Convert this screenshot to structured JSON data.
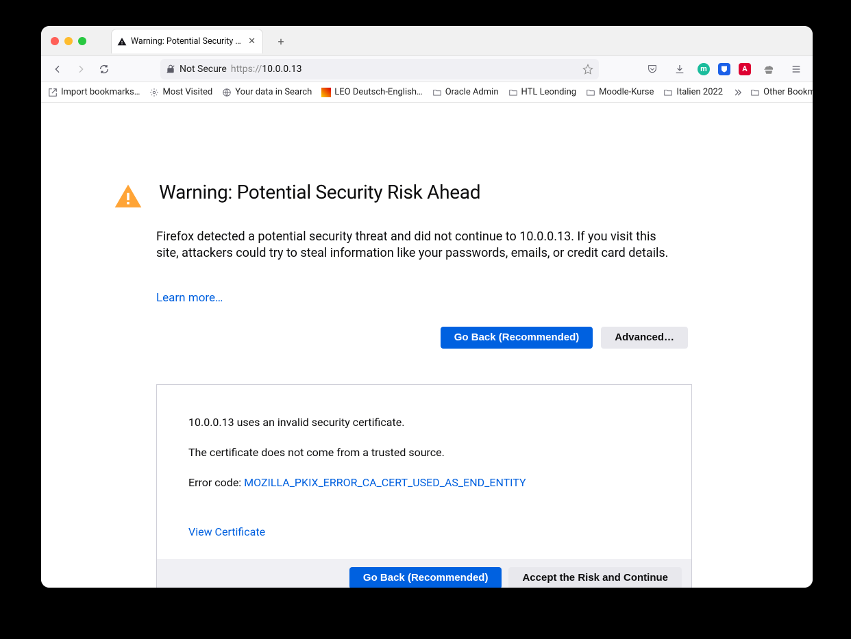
{
  "tab": {
    "title": "Warning: Potential Security Risk"
  },
  "url": {
    "security_label": "Not Secure",
    "protocol": "https://",
    "host": "10.0.0.13"
  },
  "bookmarks": {
    "import": "Import bookmarks…",
    "most_visited": "Most Visited",
    "your_data": "Your data in Search",
    "leo": "LEO Deutsch-English…",
    "oracle": "Oracle Admin",
    "htl": "HTL Leonding",
    "moodle": "Moodle-Kurse",
    "italien": "Italien 2022",
    "other": "Other Bookmarks"
  },
  "page": {
    "title": "Warning: Potential Security Risk Ahead",
    "description": "Firefox detected a potential security threat and did not continue to 10.0.0.13. If you visit this site, attackers could try to steal information like your passwords, emails, or credit card details.",
    "learn_more": "Learn more…",
    "go_back": "Go Back (Recommended)",
    "advanced": "Advanced…",
    "cert_line1": "10.0.0.13 uses an invalid security certificate.",
    "cert_line2": "The certificate does not come from a trusted source.",
    "error_label": "Error code: ",
    "error_code": "MOZILLA_PKIX_ERROR_CA_CERT_USED_AS_END_ENTITY",
    "view_cert": "View Certificate",
    "go_back2": "Go Back (Recommended)",
    "accept": "Accept the Risk and Continue"
  }
}
